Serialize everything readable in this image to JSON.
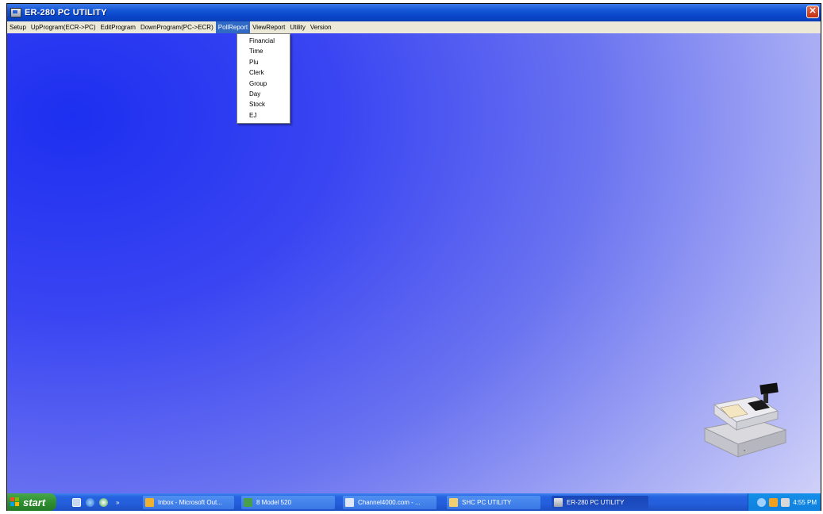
{
  "window": {
    "title": "ER-280 PC UTILITY"
  },
  "menubar": {
    "items": [
      "Setup",
      "UpProgram(ECR->PC)",
      "EditProgram",
      "DownProgram(PC->ECR)",
      "PollReport",
      "ViewReport",
      "Utility",
      "Version"
    ],
    "active": "PollReport"
  },
  "dropdown": {
    "items": [
      "Financial",
      "Time",
      "Plu",
      "Clerk",
      "Group",
      "Day",
      "Stock",
      "EJ"
    ]
  },
  "taskbar": {
    "start_label": "start",
    "tasks": [
      {
        "label": "Inbox - Microsoft Out...",
        "icon": "outlook-icon"
      },
      {
        "label": "8 Model 520",
        "icon": "app-window-icon"
      },
      {
        "label": "Channel4000.com - ...",
        "icon": "browser-icon"
      },
      {
        "label": "SHC PC UTILITY",
        "icon": "folder-icon"
      },
      {
        "label": "ER-280 PC UTILITY",
        "icon": "app-window-icon"
      }
    ],
    "clock": "4:55 PM"
  },
  "colors": {
    "titlebar": "#0a45c8",
    "desktop_deep": "#1d2ff0",
    "desktop_light": "#dcdcfa",
    "menu_highlight": "#316ac5",
    "taskbar": "#245edb",
    "start_button": "#2f8f32"
  }
}
